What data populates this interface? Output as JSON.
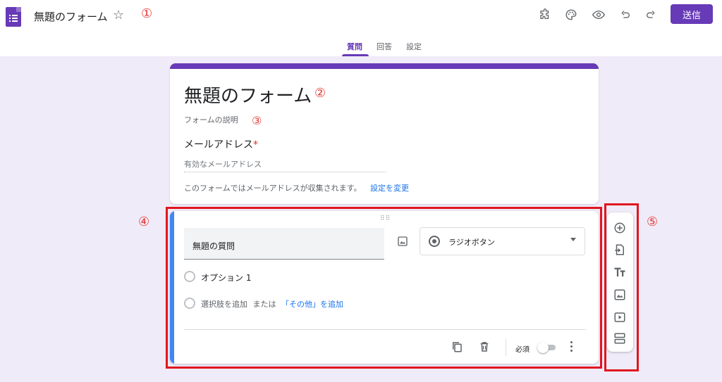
{
  "topbar": {
    "doc_title": "無題のフォーム",
    "annotation": "①",
    "send_label": "送信",
    "icons": [
      "addon-icon",
      "palette-icon",
      "preview-eye-icon",
      "undo-icon",
      "redo-icon"
    ]
  },
  "tabs": [
    {
      "label": "質問",
      "active": true
    },
    {
      "label": "回答",
      "active": false
    },
    {
      "label": "設定",
      "active": false
    }
  ],
  "header_card": {
    "title": "無題のフォーム",
    "title_annotation": "②",
    "description_placeholder": "フォームの説明",
    "description_annotation": "③",
    "email_label": "メールアドレス",
    "required_mark": "*",
    "email_placeholder": "有効なメールアドレス",
    "collect_note": "このフォームではメールアドレスが収集されます。",
    "settings_link": "設定を変更"
  },
  "question_card": {
    "annotation": "④",
    "drag_handle": "⠿⠿",
    "question_title": "無題の質問",
    "type": "ラジオボタン",
    "option_1": "オプション 1",
    "add_option": "選択肢を追加",
    "or_text": "または",
    "add_other": "「その他」を追加",
    "required_label": "必須",
    "required": false
  },
  "side_toolbar": {
    "annotation": "⑤",
    "icons": [
      "add-question-icon",
      "import-questions-icon",
      "add-title-icon",
      "add-image-icon",
      "add-video-icon",
      "add-section-icon"
    ]
  },
  "colors": {
    "accent": "#673ab7",
    "background": "#f0ebf8",
    "question_accent": "#4285f4",
    "link": "#1a73e8",
    "annotation": "#e0161e"
  }
}
